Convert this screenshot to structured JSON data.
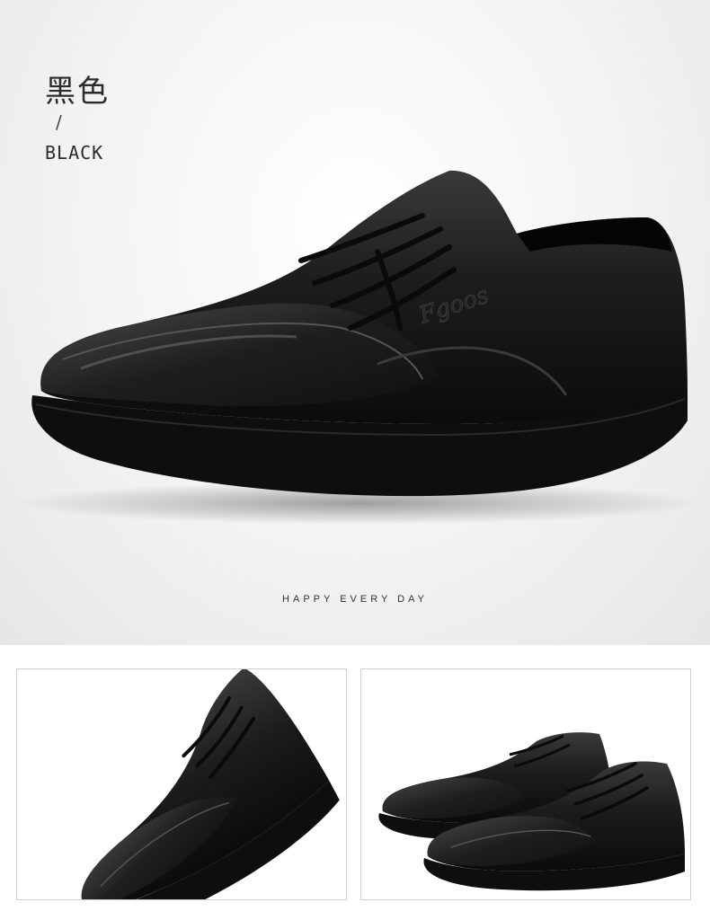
{
  "hero": {
    "color_name_cn": "黑色",
    "separator": "/",
    "color_name_en": "BLACK",
    "tagline": "HAPPY EVERY DAY",
    "logo_text": "Fgoos"
  },
  "thumbnails": [
    {
      "view": "side-angle"
    },
    {
      "view": "pair-front-angle"
    }
  ],
  "colors": {
    "shoe_leather": "#1a1a1a",
    "sole": "#0e0e0e",
    "background": "#efefef",
    "panel_border": "#cfcfcf"
  }
}
